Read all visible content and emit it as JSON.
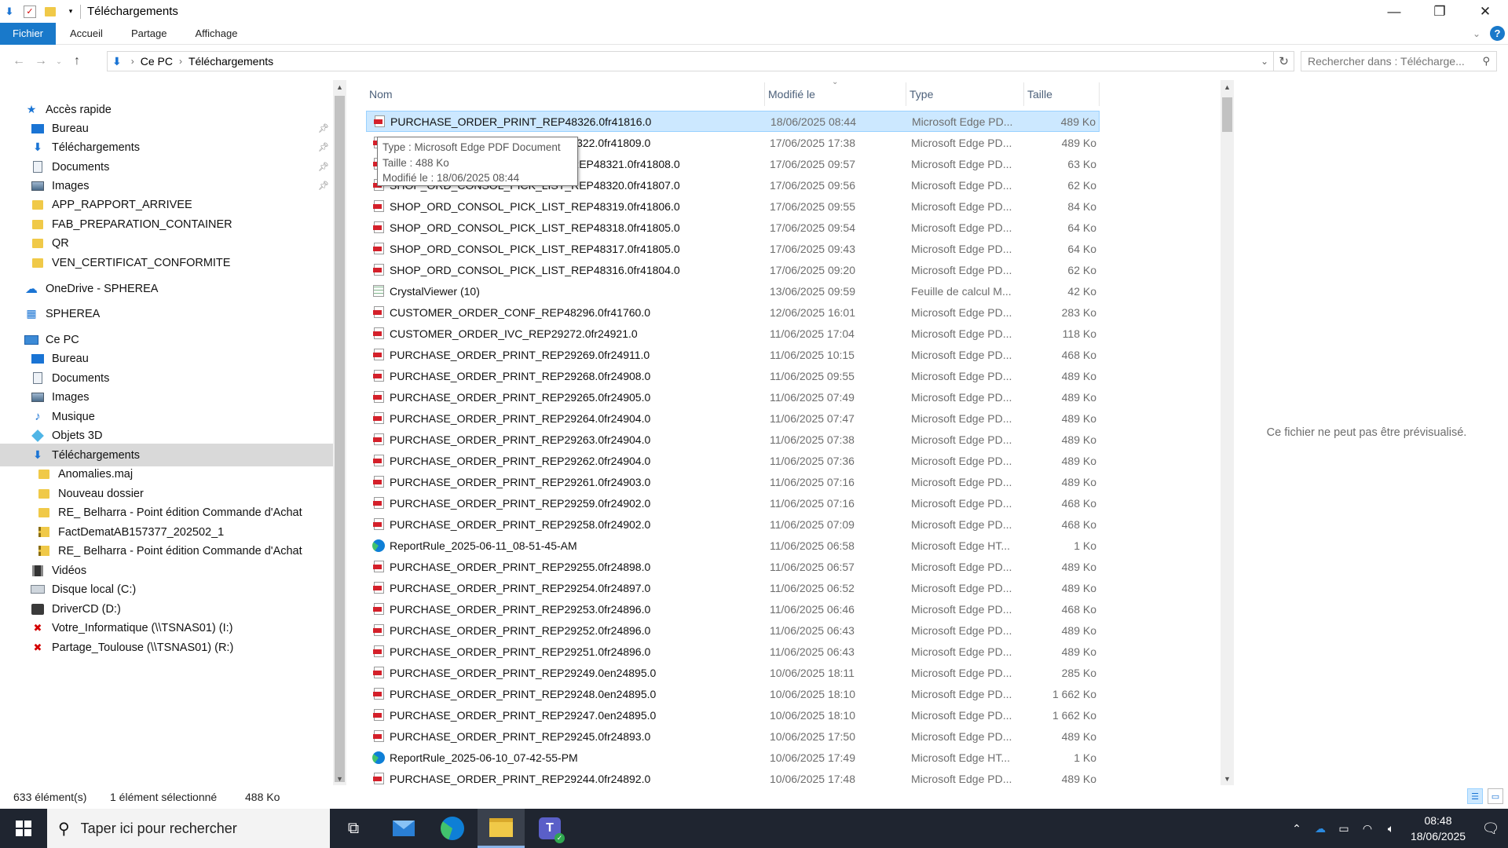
{
  "window": {
    "title": "Téléchargements"
  },
  "ribbon": {
    "tabs": [
      {
        "label": "Fichier",
        "active": true
      },
      {
        "label": "Accueil"
      },
      {
        "label": "Partage"
      },
      {
        "label": "Affichage"
      }
    ]
  },
  "address": {
    "crumbs": [
      "Ce PC",
      "Téléchargements"
    ],
    "search_placeholder": "Rechercher dans : Télécharge..."
  },
  "sidebar": {
    "items": [
      {
        "label": "Accès rapide",
        "icon": "star-icon",
        "indent": 1,
        "pinned": false
      },
      {
        "label": "Bureau",
        "icon": "desktop-icon",
        "indent": 2,
        "pinned": true
      },
      {
        "label": "Téléchargements",
        "icon": "download-arrow-icon",
        "indent": 2,
        "pinned": true
      },
      {
        "label": "Documents",
        "icon": "document-icon",
        "indent": 2,
        "pinned": true
      },
      {
        "label": "Images",
        "icon": "images-icon",
        "indent": 2,
        "pinned": true
      },
      {
        "label": "APP_RAPPORT_ARRIVEE",
        "icon": "folder-icon",
        "indent": 2,
        "pinned": false
      },
      {
        "label": "FAB_PREPARATION_CONTAINER",
        "icon": "folder-icon",
        "indent": 2,
        "pinned": false
      },
      {
        "label": "QR",
        "icon": "folder-icon",
        "indent": 2,
        "pinned": false
      },
      {
        "label": "VEN_CERTIFICAT_CONFORMITE",
        "icon": "folder-icon",
        "indent": 2,
        "pinned": false
      },
      {
        "label": "OneDrive - SPHEREA",
        "icon": "onedrive-cloud-icon",
        "indent": 1,
        "pinned": false
      },
      {
        "label": "SPHEREA",
        "icon": "building-icon",
        "indent": 1,
        "pinned": false
      },
      {
        "label": "Ce PC",
        "icon": "computer-icon",
        "indent": 1,
        "pinned": false
      },
      {
        "label": "Bureau",
        "icon": "desktop-icon",
        "indent": 2,
        "pinned": false
      },
      {
        "label": "Documents",
        "icon": "document-icon",
        "indent": 2,
        "pinned": false
      },
      {
        "label": "Images",
        "icon": "images-icon",
        "indent": 2,
        "pinned": false
      },
      {
        "label": "Musique",
        "icon": "music-note-icon",
        "indent": 2,
        "pinned": false
      },
      {
        "label": "Objets 3D",
        "icon": "cube-3d-icon",
        "indent": 2,
        "pinned": false
      },
      {
        "label": "Téléchargements",
        "icon": "download-arrow-icon",
        "indent": 2,
        "pinned": false,
        "selected": true
      },
      {
        "label": "Anomalies.maj",
        "icon": "folder-icon",
        "indent": 3,
        "pinned": false
      },
      {
        "label": "Nouveau dossier",
        "icon": "folder-icon",
        "indent": 3,
        "pinned": false
      },
      {
        "label": "RE_ Belharra - Point édition Commande d'Achat",
        "icon": "folder-icon",
        "indent": 3,
        "pinned": false
      },
      {
        "label": "FactDematAB157377_202502_1",
        "icon": "zip-folder-icon",
        "indent": 3,
        "pinned": false
      },
      {
        "label": "RE_ Belharra - Point édition Commande d'Achat",
        "icon": "zip-folder-icon",
        "indent": 3,
        "pinned": false
      },
      {
        "label": "Vidéos",
        "icon": "video-icon",
        "indent": 2,
        "pinned": false
      },
      {
        "label": "Disque local (C:)",
        "icon": "local-disk-icon",
        "indent": 2,
        "pinned": false
      },
      {
        "label": "DriverCD (D:)",
        "icon": "cd-drive-icon",
        "indent": 2,
        "pinned": false
      },
      {
        "label": "Votre_Informatique (\\\\TSNAS01) (I:)",
        "icon": "network-drive-disconnected-icon",
        "indent": 2,
        "pinned": false
      },
      {
        "label": "Partage_Toulouse (\\\\TSNAS01) (R:)",
        "icon": "network-drive-disconnected-icon",
        "indent": 2,
        "pinned": false
      }
    ]
  },
  "columns": {
    "name": "Nom",
    "modified": "Modifié le",
    "type": "Type",
    "size": "Taille"
  },
  "files": [
    {
      "name": "PURCHASE_ORDER_PRINT_REP48326.0fr41816.0",
      "date": "18/06/2025 08:44",
      "type": "Microsoft Edge PD...",
      "size": "489 Ko",
      "icon": "pdf-icon",
      "selected": true
    },
    {
      "name": "PURCHASE_ORDER_PRINT_REP48322.0fr41809.0",
      "date": "17/06/2025 17:38",
      "type": "Microsoft Edge PD...",
      "size": "489 Ko",
      "icon": "pdf-icon"
    },
    {
      "name": "SHOP_ORD_CONSOL_PICK_LIST_REP48321.0fr41808.0",
      "date": "17/06/2025 09:57",
      "type": "Microsoft Edge PD...",
      "size": "63 Ko",
      "icon": "pdf-icon"
    },
    {
      "name": "SHOP_ORD_CONSOL_PICK_LIST_REP48320.0fr41807.0",
      "date": "17/06/2025 09:56",
      "type": "Microsoft Edge PD...",
      "size": "62 Ko",
      "icon": "pdf-icon"
    },
    {
      "name": "SHOP_ORD_CONSOL_PICK_LIST_REP48319.0fr41806.0",
      "date": "17/06/2025 09:55",
      "type": "Microsoft Edge PD...",
      "size": "84 Ko",
      "icon": "pdf-icon"
    },
    {
      "name": "SHOP_ORD_CONSOL_PICK_LIST_REP48318.0fr41805.0",
      "date": "17/06/2025 09:54",
      "type": "Microsoft Edge PD...",
      "size": "64 Ko",
      "icon": "pdf-icon"
    },
    {
      "name": "SHOP_ORD_CONSOL_PICK_LIST_REP48317.0fr41805.0",
      "date": "17/06/2025 09:43",
      "type": "Microsoft Edge PD...",
      "size": "64 Ko",
      "icon": "pdf-icon"
    },
    {
      "name": "SHOP_ORD_CONSOL_PICK_LIST_REP48316.0fr41804.0",
      "date": "17/06/2025 09:20",
      "type": "Microsoft Edge PD...",
      "size": "62 Ko",
      "icon": "pdf-icon"
    },
    {
      "name": "CrystalViewer (10)",
      "date": "13/06/2025 09:59",
      "type": "Feuille de calcul M...",
      "size": "42 Ko",
      "icon": "spreadsheet-icon"
    },
    {
      "name": "CUSTOMER_ORDER_CONF_REP48296.0fr41760.0",
      "date": "12/06/2025 16:01",
      "type": "Microsoft Edge PD...",
      "size": "283 Ko",
      "icon": "pdf-icon"
    },
    {
      "name": "CUSTOMER_ORDER_IVC_REP29272.0fr24921.0",
      "date": "11/06/2025 17:04",
      "type": "Microsoft Edge PD...",
      "size": "118 Ko",
      "icon": "pdf-icon"
    },
    {
      "name": "PURCHASE_ORDER_PRINT_REP29269.0fr24911.0",
      "date": "11/06/2025 10:15",
      "type": "Microsoft Edge PD...",
      "size": "468 Ko",
      "icon": "pdf-icon"
    },
    {
      "name": "PURCHASE_ORDER_PRINT_REP29268.0fr24908.0",
      "date": "11/06/2025 09:55",
      "type": "Microsoft Edge PD...",
      "size": "489 Ko",
      "icon": "pdf-icon"
    },
    {
      "name": "PURCHASE_ORDER_PRINT_REP29265.0fr24905.0",
      "date": "11/06/2025 07:49",
      "type": "Microsoft Edge PD...",
      "size": "489 Ko",
      "icon": "pdf-icon"
    },
    {
      "name": "PURCHASE_ORDER_PRINT_REP29264.0fr24904.0",
      "date": "11/06/2025 07:47",
      "type": "Microsoft Edge PD...",
      "size": "489 Ko",
      "icon": "pdf-icon"
    },
    {
      "name": "PURCHASE_ORDER_PRINT_REP29263.0fr24904.0",
      "date": "11/06/2025 07:38",
      "type": "Microsoft Edge PD...",
      "size": "489 Ko",
      "icon": "pdf-icon"
    },
    {
      "name": "PURCHASE_ORDER_PRINT_REP29262.0fr24904.0",
      "date": "11/06/2025 07:36",
      "type": "Microsoft Edge PD...",
      "size": "489 Ko",
      "icon": "pdf-icon"
    },
    {
      "name": "PURCHASE_ORDER_PRINT_REP29261.0fr24903.0",
      "date": "11/06/2025 07:16",
      "type": "Microsoft Edge PD...",
      "size": "489 Ko",
      "icon": "pdf-icon"
    },
    {
      "name": "PURCHASE_ORDER_PRINT_REP29259.0fr24902.0",
      "date": "11/06/2025 07:16",
      "type": "Microsoft Edge PD...",
      "size": "468 Ko",
      "icon": "pdf-icon"
    },
    {
      "name": "PURCHASE_ORDER_PRINT_REP29258.0fr24902.0",
      "date": "11/06/2025 07:09",
      "type": "Microsoft Edge PD...",
      "size": "468 Ko",
      "icon": "pdf-icon"
    },
    {
      "name": "ReportRule_2025-06-11_08-51-45-AM",
      "date": "11/06/2025 06:58",
      "type": "Microsoft Edge HT...",
      "size": "1 Ko",
      "icon": "edge-browser-icon"
    },
    {
      "name": "PURCHASE_ORDER_PRINT_REP29255.0fr24898.0",
      "date": "11/06/2025 06:57",
      "type": "Microsoft Edge PD...",
      "size": "489 Ko",
      "icon": "pdf-icon"
    },
    {
      "name": "PURCHASE_ORDER_PRINT_REP29254.0fr24897.0",
      "date": "11/06/2025 06:52",
      "type": "Microsoft Edge PD...",
      "size": "489 Ko",
      "icon": "pdf-icon"
    },
    {
      "name": "PURCHASE_ORDER_PRINT_REP29253.0fr24896.0",
      "date": "11/06/2025 06:46",
      "type": "Microsoft Edge PD...",
      "size": "468 Ko",
      "icon": "pdf-icon"
    },
    {
      "name": "PURCHASE_ORDER_PRINT_REP29252.0fr24896.0",
      "date": "11/06/2025 06:43",
      "type": "Microsoft Edge PD...",
      "size": "489 Ko",
      "icon": "pdf-icon"
    },
    {
      "name": "PURCHASE_ORDER_PRINT_REP29251.0fr24896.0",
      "date": "11/06/2025 06:43",
      "type": "Microsoft Edge PD...",
      "size": "489 Ko",
      "icon": "pdf-icon"
    },
    {
      "name": "PURCHASE_ORDER_PRINT_REP29249.0en24895.0",
      "date": "10/06/2025 18:11",
      "type": "Microsoft Edge PD...",
      "size": "285 Ko",
      "icon": "pdf-icon"
    },
    {
      "name": "PURCHASE_ORDER_PRINT_REP29248.0en24895.0",
      "date": "10/06/2025 18:10",
      "type": "Microsoft Edge PD...",
      "size": "1 662 Ko",
      "icon": "pdf-icon"
    },
    {
      "name": "PURCHASE_ORDER_PRINT_REP29247.0en24895.0",
      "date": "10/06/2025 18:10",
      "type": "Microsoft Edge PD...",
      "size": "1 662 Ko",
      "icon": "pdf-icon"
    },
    {
      "name": "PURCHASE_ORDER_PRINT_REP29245.0fr24893.0",
      "date": "10/06/2025 17:50",
      "type": "Microsoft Edge PD...",
      "size": "489 Ko",
      "icon": "pdf-icon"
    },
    {
      "name": "ReportRule_2025-06-10_07-42-55-PM",
      "date": "10/06/2025 17:49",
      "type": "Microsoft Edge HT...",
      "size": "1 Ko",
      "icon": "edge-browser-icon"
    },
    {
      "name": "PURCHASE_ORDER_PRINT_REP29244.0fr24892.0",
      "date": "10/06/2025 17:48",
      "type": "Microsoft Edge PD...",
      "size": "489 Ko",
      "icon": "pdf-icon"
    }
  ],
  "tooltip": {
    "line1": "Type : Microsoft Edge PDF Document",
    "line2": "Taille : 488 Ko",
    "line3": "Modifié le : 18/06/2025 08:44"
  },
  "preview": {
    "message": "Ce fichier ne peut pas être prévisualisé."
  },
  "status": {
    "count": "633 élément(s)",
    "selection": "1 élément sélectionné",
    "size": "488 Ko"
  },
  "taskbar": {
    "search_placeholder": "Taper ici pour rechercher",
    "time": "08:48",
    "date": "18/06/2025"
  }
}
